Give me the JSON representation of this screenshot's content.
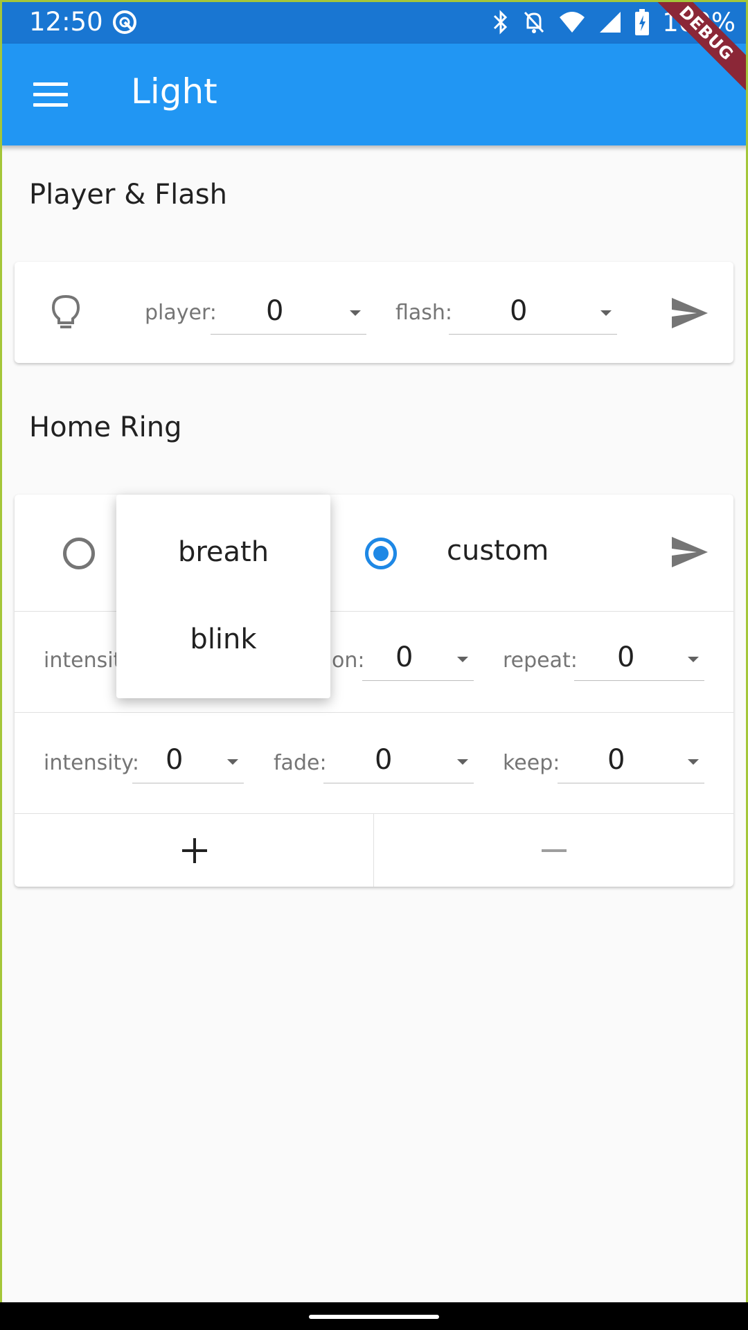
{
  "status": {
    "time": "12:50",
    "battery": "100%"
  },
  "appbar": {
    "title": "Light"
  },
  "debug_banner": "DEBUG",
  "player_flash": {
    "section_title": "Player & Flash",
    "player_label": "player:",
    "player_value": "0",
    "flash_label": "flash:",
    "flash_value": "0"
  },
  "home_ring": {
    "section_title": "Home Ring",
    "mode_options": [
      "breath",
      "blink"
    ],
    "custom_label": "custom",
    "selected_mode": "custom",
    "row1": {
      "intensity_label": "intensit",
      "duration_label": "on:",
      "duration_value": "0",
      "repeat_label": "repeat:",
      "repeat_value": "0"
    },
    "row2": {
      "intensity_label": "intensity:",
      "intensity_value": "0",
      "fade_label": "fade:",
      "fade_value": "0",
      "keep_label": "keep:",
      "keep_value": "0"
    },
    "add_label": "+",
    "remove_label": "—"
  },
  "colors": {
    "primary": "#2196f3",
    "status": "#1976d2",
    "accent": "#1e88e5",
    "debug": "#8b2737"
  }
}
